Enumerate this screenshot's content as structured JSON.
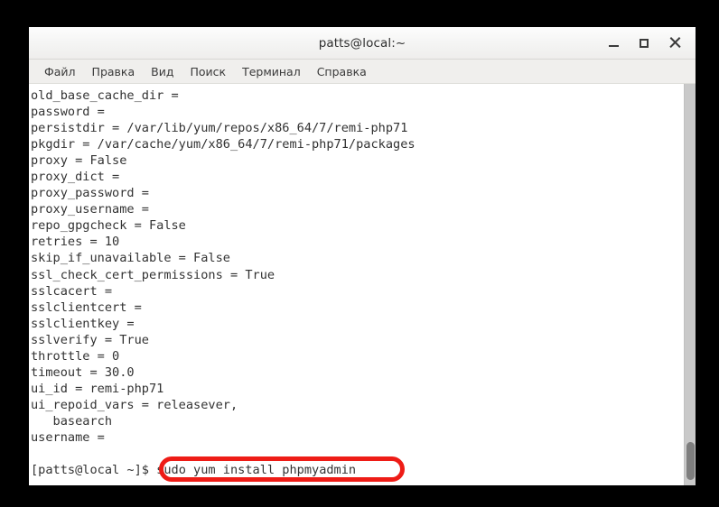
{
  "window": {
    "title": "patts@local:~",
    "controls": [
      {
        "name": "minimize",
        "label": "–"
      },
      {
        "name": "maximize",
        "label": "□"
      },
      {
        "name": "close",
        "label": "×"
      }
    ]
  },
  "menubar": {
    "items": [
      {
        "label": "Файл"
      },
      {
        "label": "Правка"
      },
      {
        "label": "Вид"
      },
      {
        "label": "Поиск"
      },
      {
        "label": "Терминал"
      },
      {
        "label": "Справка"
      }
    ]
  },
  "terminal": {
    "lines": [
      "old_base_cache_dir =",
      "password =",
      "persistdir = /var/lib/yum/repos/x86_64/7/remi-php71",
      "pkgdir = /var/cache/yum/x86_64/7/remi-php71/packages",
      "proxy = False",
      "proxy_dict =",
      "proxy_password =",
      "proxy_username =",
      "repo_gpgcheck = False",
      "retries = 10",
      "skip_if_unavailable = False",
      "ssl_check_cert_permissions = True",
      "sslcacert =",
      "sslclientcert =",
      "sslclientkey =",
      "sslverify = True",
      "throttle = 0",
      "timeout = 30.0",
      "ui_id = remi-php71",
      "ui_repoid_vars = releasever,",
      "   basearch",
      "username =",
      ""
    ],
    "prompt": "[patts@local ~]$ ",
    "command": "sudo yum install phpmyadmin"
  },
  "annotation": {
    "highlight_color": "#ee1c16",
    "target_text": "sudo yum install phpmyadmin"
  },
  "scrollbar": {
    "position": "bottom"
  }
}
